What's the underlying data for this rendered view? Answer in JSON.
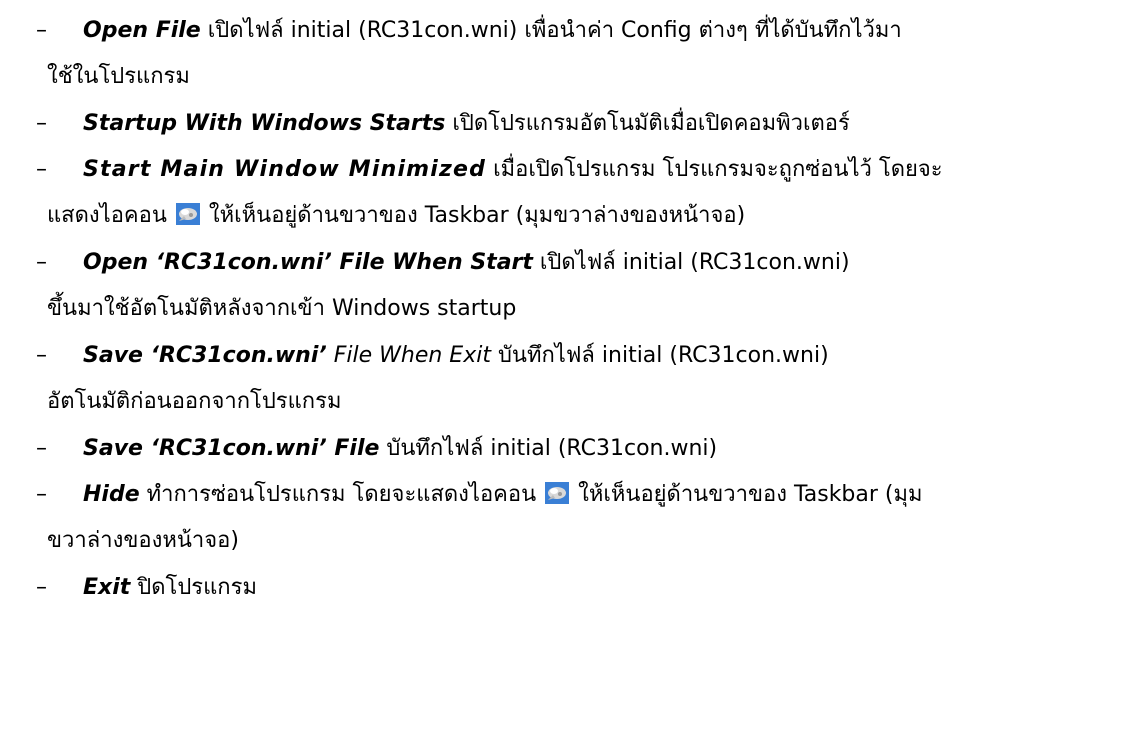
{
  "items": [
    {
      "title": "Open File",
      "desc": " เปิดไฟล์ initial (RC31con.wni) เพื่อนำค่า Config ต่างๆ ที่ได้บันทึกไว้มา",
      "desc_cont": "ใช้ในโปรแกรม"
    },
    {
      "title": "Startup With Windows Starts",
      "desc": " เปิดโปรแกรมอัตโนมัติเมื่อเปิดคอมพิวเตอร์"
    },
    {
      "title": "Start Main Window Minimized",
      "desc": "  เมื่อเปิดโปรแกรม โปรแกรมจะถูกซ่อนไว้ โดยจะ",
      "desc_cont_before_icon": "แสดงไอคอน ",
      "desc_cont_after_icon": " ให้เห็นอยู่ด้านขวาของ Taskbar (มุมขวาล่างของหน้าจอ)"
    },
    {
      "title": "Open ‘RC31con.wni’ File When Start",
      "desc": "  เปิดไฟล์ initial  (RC31con.wni)",
      "desc_cont": "ขึ้นมาใช้อัตโนมัติหลังจากเข้า Windows startup"
    },
    {
      "title": "Save ‘RC31con.wni’",
      "title_italic": " File When Exit",
      "desc": "  บันทึกไฟล์ initial  (RC31con.wni)",
      "desc_cont": "อัตโนมัติก่อนออกจากโปรแกรม"
    },
    {
      "title": "Save ‘RC31con.wni’ File",
      "desc": " บันทึกไฟล์ initial (RC31con.wni)"
    },
    {
      "title": "Hide",
      "desc_before_icon": "  ทำการซ่อนโปรแกรม โดยจะแสดงไอคอน ",
      "desc_after_icon": " ให้เห็นอยู่ด้านขวาของ Taskbar  (มุม",
      "desc_cont": "ขวาล่างของหน้าจอ)"
    },
    {
      "title": "Exit",
      "desc": " ปิดโปรแกรม"
    }
  ],
  "bullet": "–",
  "icon": {
    "name": "tray-icon",
    "colors": {
      "background": "#3a7fd5",
      "foreground": "#d9d9d9"
    }
  }
}
